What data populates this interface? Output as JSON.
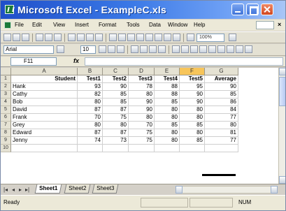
{
  "window": {
    "title": "Microsoft Excel - ExampleC.xls"
  },
  "menu": [
    "File",
    "Edit",
    "View",
    "Insert",
    "Format",
    "Tools",
    "Data",
    "Window",
    "Help"
  ],
  "toolbar": {
    "zoom": "100%"
  },
  "format_bar": {
    "font": "Arial",
    "size": "10"
  },
  "formula_bar": {
    "cell_ref": "F11",
    "fx": "fx",
    "value": ""
  },
  "columns": [
    "A",
    "B",
    "C",
    "D",
    "E",
    "F",
    "G"
  ],
  "selected_column": "F",
  "rows": [
    "1",
    "2",
    "3",
    "4",
    "5",
    "6",
    "7",
    "8",
    "9",
    "10"
  ],
  "table": {
    "headers": [
      "Student",
      "Test1",
      "Test2",
      "Test3",
      "Test4",
      "Test5",
      "Average"
    ],
    "data": [
      [
        "Hank",
        "93",
        "90",
        "78",
        "88",
        "95",
        "90"
      ],
      [
        "Cathy",
        "82",
        "85",
        "80",
        "88",
        "90",
        "85"
      ],
      [
        "Bob",
        "80",
        "85",
        "90",
        "85",
        "90",
        "86"
      ],
      [
        "David",
        "87",
        "87",
        "90",
        "80",
        "80",
        "84"
      ],
      [
        "Frank",
        "70",
        "75",
        "80",
        "80",
        "80",
        "77"
      ],
      [
        "Grey",
        "80",
        "80",
        "70",
        "85",
        "85",
        "80"
      ],
      [
        "Edward",
        "87",
        "87",
        "75",
        "80",
        "80",
        "81"
      ],
      [
        "Jenny",
        "74",
        "73",
        "75",
        "80",
        "85",
        "77"
      ]
    ]
  },
  "sheets": [
    "Sheet1",
    "Sheet2",
    "Sheet3"
  ],
  "active_sheet": "Sheet1",
  "status": {
    "text": "Ready",
    "mode": "NUM"
  }
}
